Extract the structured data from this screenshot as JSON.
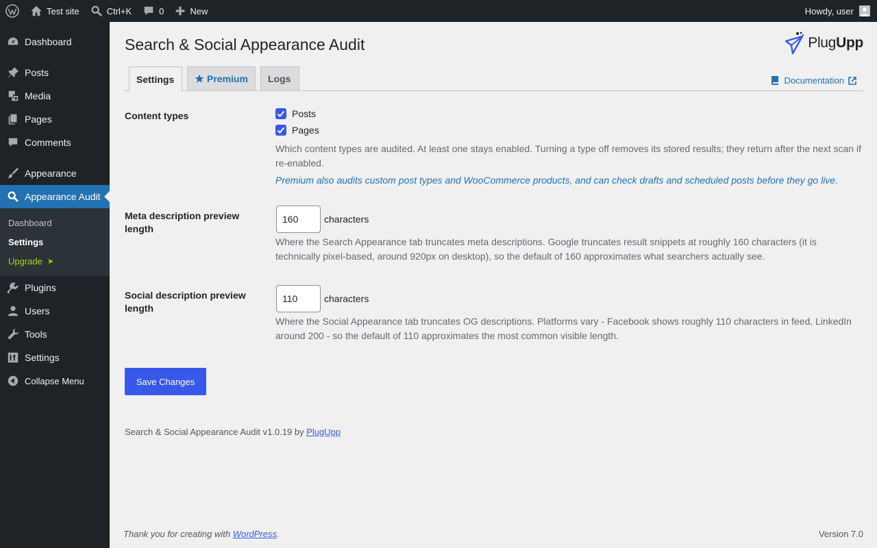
{
  "admin_bar": {
    "site_name": "Test site",
    "search_shortcut": "Ctrl+K",
    "comments_count": "0",
    "new_label": "New",
    "greeting": "Howdy, user"
  },
  "sidebar": {
    "items": [
      {
        "label": "Dashboard",
        "icon": "dashboard-icon"
      },
      {
        "label": "Posts",
        "icon": "pushpin-icon"
      },
      {
        "label": "Media",
        "icon": "media-icon"
      },
      {
        "label": "Pages",
        "icon": "pages-icon"
      },
      {
        "label": "Comments",
        "icon": "comment-icon"
      },
      {
        "label": "Appearance",
        "icon": "paintbrush-icon"
      },
      {
        "label": "Appearance Audit",
        "icon": "search-icon"
      },
      {
        "label": "Plugins",
        "icon": "plugin-icon"
      },
      {
        "label": "Users",
        "icon": "user-icon"
      },
      {
        "label": "Tools",
        "icon": "wrench-icon"
      },
      {
        "label": "Settings",
        "icon": "settings-sliders-icon"
      }
    ],
    "submenu": [
      {
        "label": "Dashboard"
      },
      {
        "label": "Settings"
      },
      {
        "label": "Upgrade",
        "suffix": "➤"
      }
    ],
    "collapse_label": "Collapse Menu"
  },
  "page": {
    "title": "Search & Social Appearance Audit",
    "brand_plug": "Plug",
    "brand_upp": "Upp"
  },
  "tabs": [
    {
      "label": "Settings"
    },
    {
      "label": "Premium"
    },
    {
      "label": "Logs"
    }
  ],
  "documentation_label": "Documentation",
  "settings": {
    "content_types": {
      "label": "Content types",
      "options": [
        {
          "label": "Posts",
          "checked": true
        },
        {
          "label": "Pages",
          "checked": true
        }
      ],
      "description": "Which content types are audited. At least one stays enabled. Turning a type off removes its stored results; they return after the next scan if re-enabled.",
      "premium_note": "Premium also audits custom post types and WooCommerce products, and can check drafts and scheduled posts before they go live."
    },
    "meta_length": {
      "label": "Meta description preview length",
      "value": "160",
      "unit": "characters",
      "description": "Where the Search Appearance tab truncates meta descriptions. Google truncates result snippets at roughly 160 characters (it is technically pixel-based, around 920px on desktop), so the default of 160 approximates what searchers actually see."
    },
    "social_length": {
      "label": "Social description preview length",
      "value": "110",
      "unit": "characters",
      "description": "Where the Social Appearance tab truncates OG descriptions. Platforms vary - Facebook shows roughly 110 characters in feed, LinkedIn around 200 - so the default of 110 approximates the most common visible length."
    },
    "save_label": "Save Changes"
  },
  "plugin_footer": {
    "text": "Search & Social Appearance Audit v1.0.19 by",
    "link": "PlugUpp"
  },
  "wp_footer": {
    "text": "Thank you for creating with",
    "link": "WordPress",
    "end": ".",
    "version": "Version 7.0"
  },
  "colors": {
    "accent": "#3858e9",
    "sidebar_current": "#2271b1",
    "admin_dark": "#1d2327",
    "upgrade_green": "#9ee000"
  }
}
